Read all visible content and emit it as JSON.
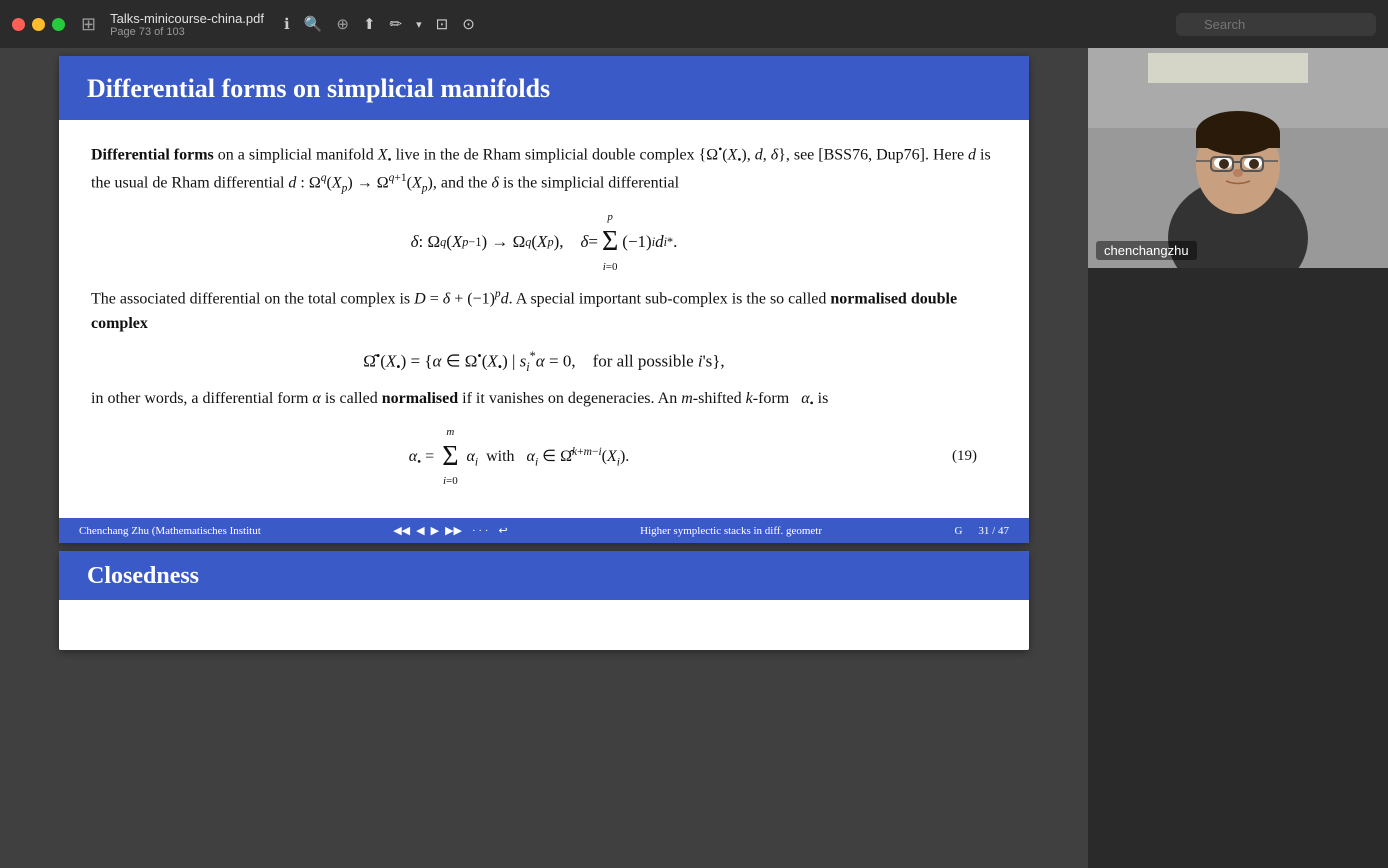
{
  "titlebar": {
    "filename": "Talks-minicourse-china.pdf",
    "page_info": "Page 73 of 103",
    "search_placeholder": "Search"
  },
  "slide": {
    "title": "Differential forms on simplicial manifolds",
    "body": {
      "para1_start": "Differential forms",
      "para1_rest": " on a simplicial manifold X• live in the de Rham simplicial double complex {Ω•(X•), d, δ}, see [BSS76, Dup76]. Here d is the usual de Rham differential d : Ω",
      "para2": "The associated differential on the total complex is D = δ + (−1)",
      "para2_end": "d. A special important sub-complex is the so called ",
      "bold1": "normalised double complex",
      "para3": "in other words, a differential form α is called ",
      "bold2": "normalised",
      "para3_end": " if it vanishes on degeneracies. An m-shifted k-form  α• is",
      "eq_number": "(19)"
    },
    "footer": {
      "left": "Chenchang Zhu (Mathematisches Institut",
      "center": "Higher symplectic stacks in diff. geometr",
      "right_g": "G",
      "right_page": "31 / 47"
    }
  },
  "next_slide": {
    "title": "Closedness"
  },
  "webcam": {
    "label": "chenchangzhu"
  }
}
